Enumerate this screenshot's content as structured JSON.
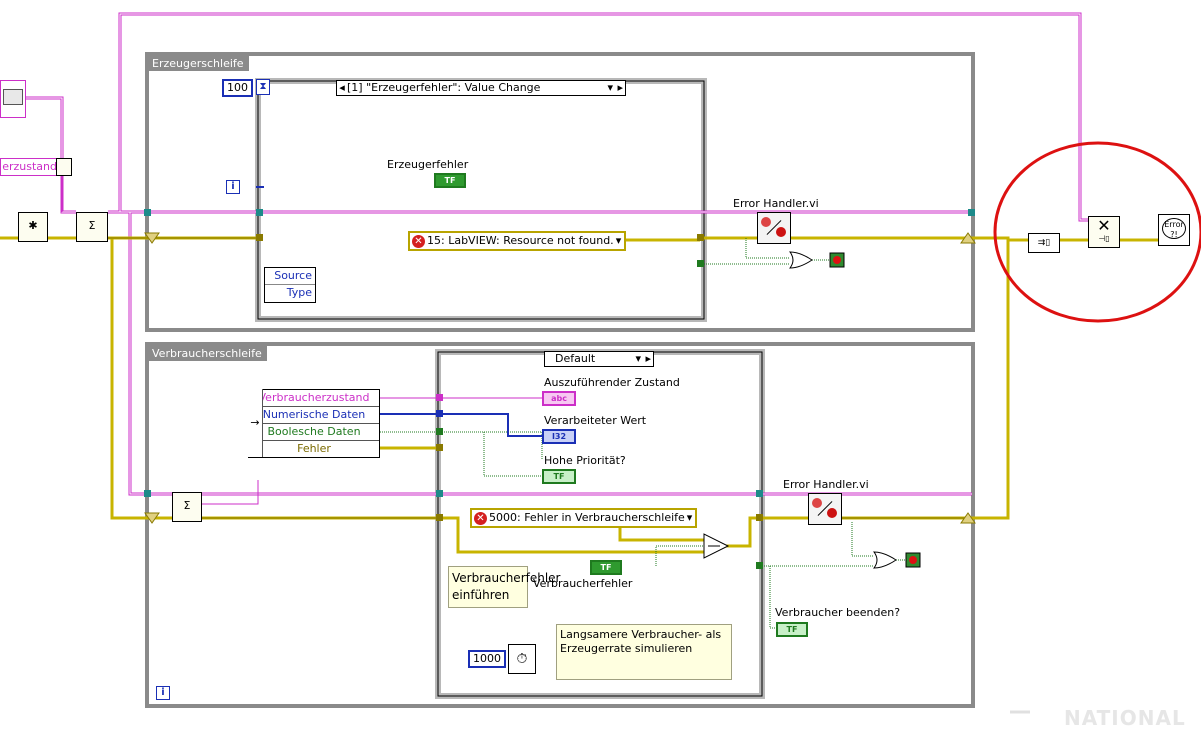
{
  "loops": {
    "producer_title": "Erzeugerschleife",
    "consumer_title": "Verbraucherschleife"
  },
  "left": {
    "state_label": "erzustand"
  },
  "producer": {
    "timeout": "100",
    "event_case": "[1] \"Erzeugerfehler\": Value Change",
    "control_label": "Erzeugerfehler",
    "error_constant": "15: LabVIEW: Resource not found.",
    "error_handler": "Error Handler.vi",
    "event_source": "Source",
    "event_type": "Type"
  },
  "consumer": {
    "case_selector": "Default",
    "unbundle": [
      "Verbraucherzustand",
      "Numerische Daten",
      "Boolesche Daten",
      "Fehler"
    ],
    "out_state": "Auszuführender Zustand",
    "out_value": "Verarbeiteter Wert",
    "out_priority": "Hohe Priorität?",
    "error_constant": "5000: Fehler in Verbraucherschleife",
    "control_label": "Verbraucherfehler",
    "comment_inject": "Verbraucherfehler einführen",
    "comment_slow": "Langsamere Verbraucher- als Erzeugerrate simulieren",
    "wait_ms": "1000",
    "error_handler": "Error Handler.vi",
    "stop_label": "Verbraucher beenden?"
  },
  "indicators": {
    "string_type": "abc",
    "int_type": "I32",
    "bool_type": "TF"
  },
  "icons": {
    "error_icon_text": "Error"
  },
  "watermark": "NATIONAL",
  "colors": {
    "error_wire": "#c8b400",
    "queue_wire": "#cc2fc8",
    "int_wire": "#1a2fb5",
    "bool_wire": "#1f7a1f",
    "highlight": "#dd1111"
  }
}
